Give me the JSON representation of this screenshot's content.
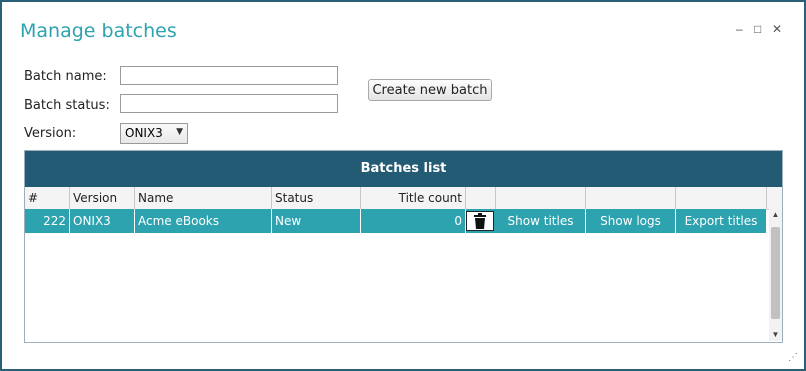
{
  "window": {
    "title": "Manage batches",
    "minimize": "–",
    "maximize": "□",
    "close": "✕",
    "resize_grip": "⋰"
  },
  "form": {
    "batch_name_label": "Batch name:",
    "batch_name_value": "",
    "batch_status_label": "Batch status:",
    "batch_status_value": "",
    "version_label": "Version:",
    "version_value": "ONIX3",
    "create_button": "Create new batch"
  },
  "grid": {
    "title": "Batches list",
    "columns": [
      "#",
      "Version",
      "Name",
      "Status",
      "Title count",
      "",
      "",
      "",
      ""
    ],
    "rows": [
      {
        "id": "222",
        "version": "ONIX3",
        "name": "Acme eBooks",
        "status": "New",
        "title_count": "0",
        "show_titles": "Show titles",
        "show_logs": "Show logs",
        "export_titles": "Export titles"
      }
    ]
  },
  "colors": {
    "header": "#235a74",
    "selected_row": "#2ea3b0",
    "title": "#2ea3b0",
    "border": "#2a5f78"
  }
}
